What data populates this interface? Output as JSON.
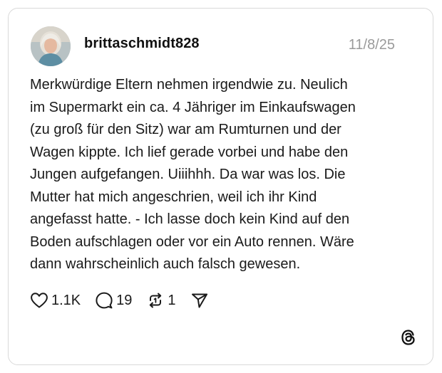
{
  "post": {
    "username": "brittaschmidt828",
    "date": "11/8/25",
    "text": "Merkwürdige Eltern nehmen irgendwie zu. Neulich\nim Supermarkt ein ca. 4 Jähriger im Einkaufswagen\n(zu groß für den Sitz) war am Rumturnen und der\nWagen kippte. Ich lief gerade vorbei und habe den\nJungen aufgefangen. Uiiihhh. Da war was los. Die\nMutter hat mich angeschrien, weil ich ihr Kind\nangefasst hatte. - Ich lasse doch kein Kind auf den\nBoden aufschlagen oder vor ein Auto rennen. Wäre\ndann wahrscheinlich auch falsch gewesen."
  },
  "actions": {
    "likes": "1.1K",
    "replies": "19",
    "reposts": "1"
  },
  "icons": {
    "like": "heart-icon",
    "reply": "comment-bubble-icon",
    "repost": "repost-icon",
    "share": "send-icon",
    "brand": "threads-logo-icon"
  },
  "colors": {
    "text": "#1a1a1a",
    "muted": "#9a9a9a",
    "border": "#d9d9d9"
  }
}
